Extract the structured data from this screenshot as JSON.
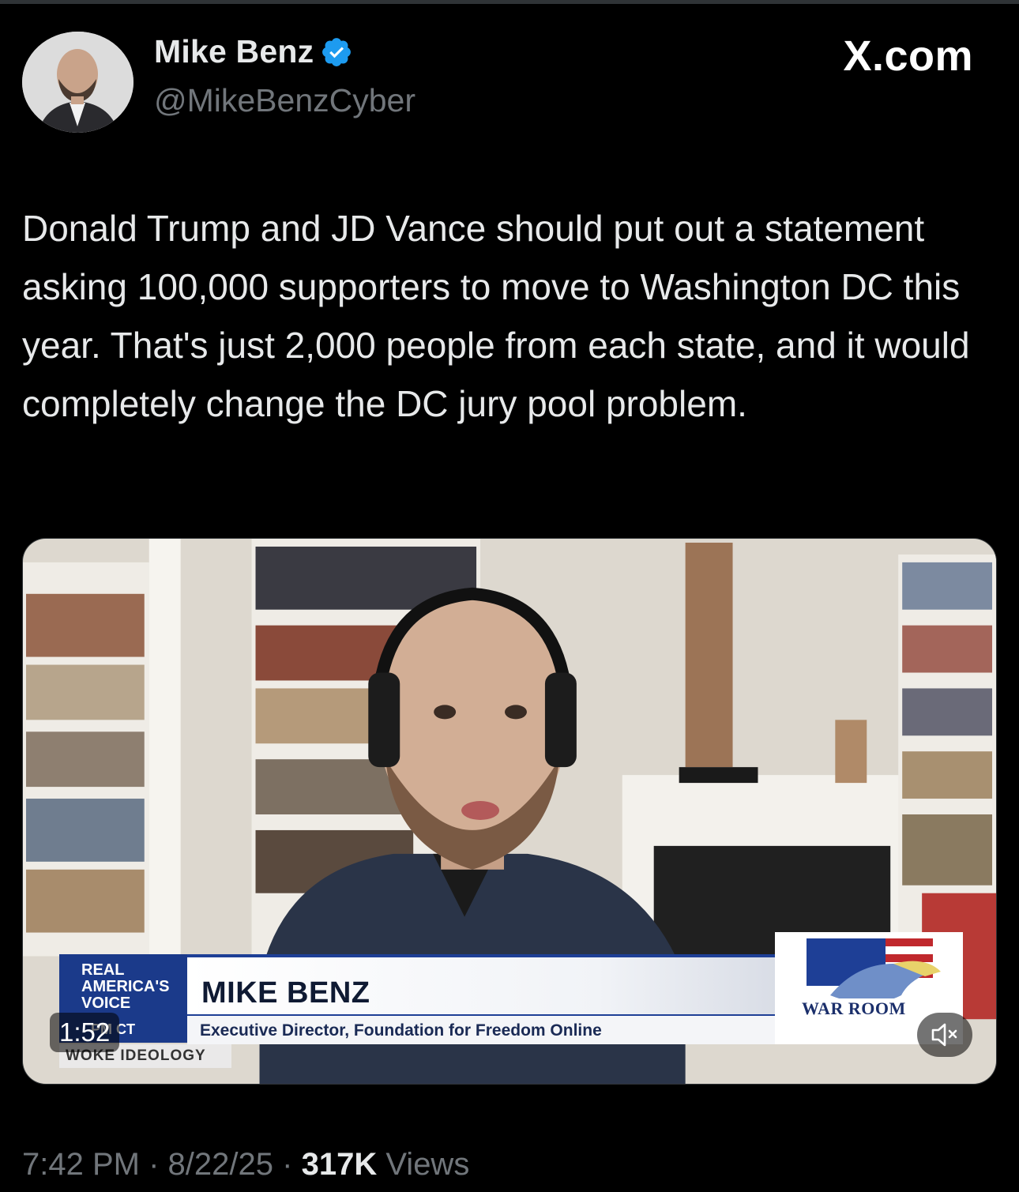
{
  "brand": "X.com",
  "author": {
    "name": "Mike Benz",
    "handle": "@MikeBenzCyber",
    "verified": true
  },
  "tweet": {
    "text": "Donald Trump and JD Vance should put out a statement asking 100,000 supporters to move to Washington DC this year. That's just 2,000 people from each state, and it would completely change the DC jury pool problem."
  },
  "video": {
    "duration": "1:52",
    "lower_third": {
      "logo_lines": [
        "REAL",
        "AMERICA'S",
        "VOICE"
      ],
      "name": "MIKE BENZ",
      "title": "Executive Director, Foundation for Freedom Online",
      "time_fragment": "PM CT",
      "topic": "WOKE IDEOLOGY",
      "show_logo": "WAR ROOM"
    }
  },
  "meta": {
    "time": "7:42 PM",
    "separator": "·",
    "date": "8/22/25",
    "views_count": "317K",
    "views_label": "Views"
  },
  "colors": {
    "background": "#000000",
    "text": "#e7e9ea",
    "muted": "#71767b",
    "verified": "#1d9bf0"
  }
}
